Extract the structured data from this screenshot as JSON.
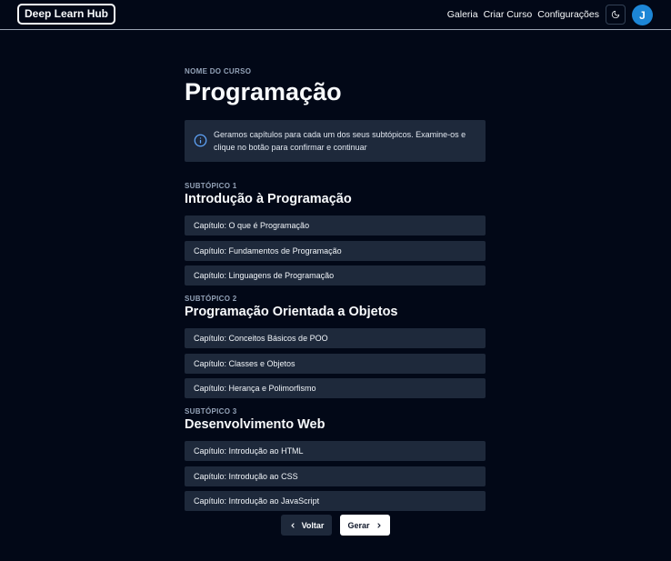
{
  "header": {
    "logo": "Deep Learn Hub",
    "nav": [
      "Galeria",
      "Criar Curso",
      "Configurações"
    ],
    "theme_icon": "moon-icon",
    "avatar_initial": "J"
  },
  "course": {
    "label": "NOME DO CURSO",
    "title": "Programação"
  },
  "alert": {
    "icon": "info-icon",
    "text": "Geramos capítulos para cada um dos seus subtópicos. Examine-os e clique no botão para confirmar e continuar"
  },
  "subtopics": [
    {
      "label": "SUBTÓPICO 1",
      "title": "Introdução à Programação",
      "chapters": [
        "Capítulo: O que é Programação",
        "Capítulo: Fundamentos de Programação",
        "Capítulo: Linguagens de Programação"
      ]
    },
    {
      "label": "SUBTÓPICO 2",
      "title": "Programação Orientada a Objetos",
      "chapters": [
        "Capítulo: Conceitos Básicos de POO",
        "Capítulo: Classes e Objetos",
        "Capítulo: Herança e Polimorfismo"
      ]
    },
    {
      "label": "SUBTÓPICO 3",
      "title": "Desenvolvimento Web",
      "chapters": [
        "Capítulo: Introdução ao HTML",
        "Capítulo: Introdução ao CSS",
        "Capítulo: Introdução ao JavaScript"
      ]
    }
  ],
  "actions": {
    "back_label": "Voltar",
    "back_icon": "chevron-left-icon",
    "generate_label": "Gerar",
    "generate_icon": "chevron-right-icon"
  }
}
